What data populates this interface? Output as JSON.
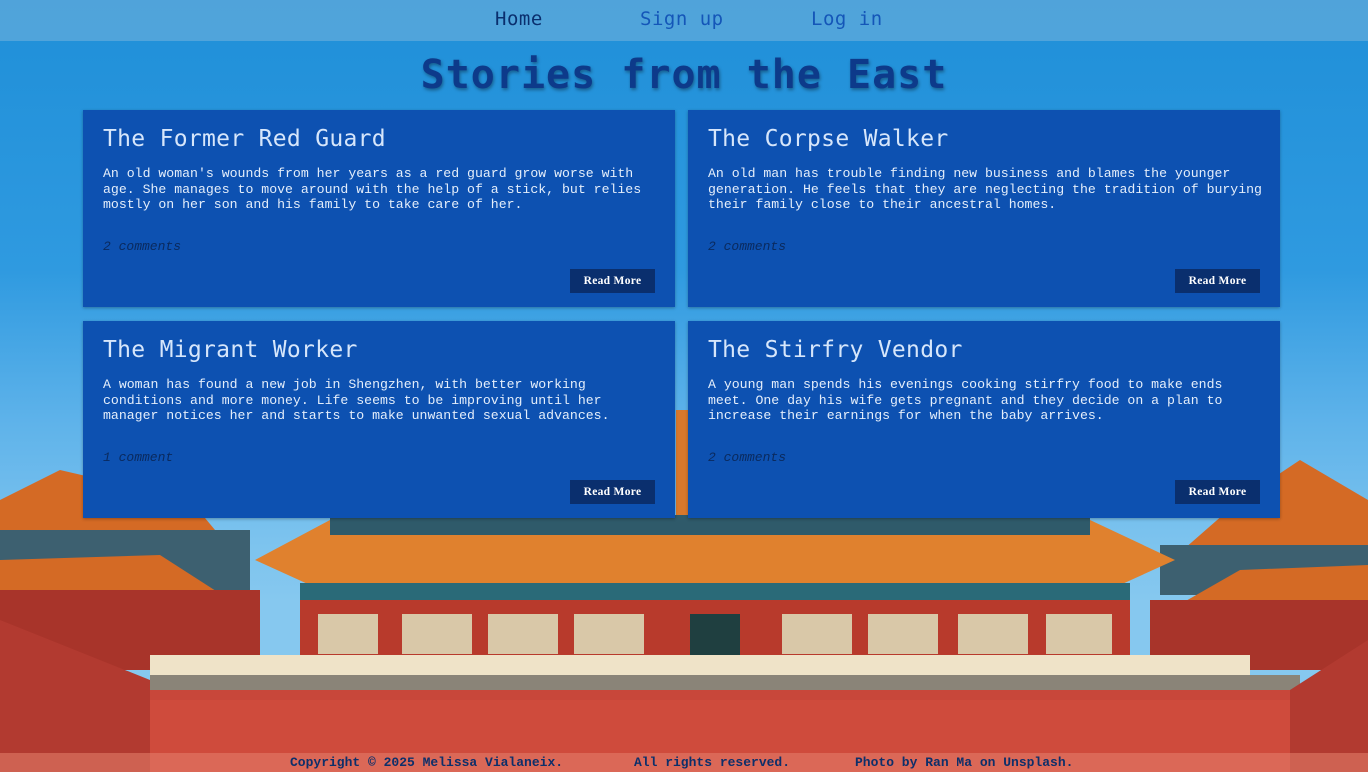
{
  "nav": {
    "home": "Home",
    "signup": "Sign up",
    "login": "Log in"
  },
  "page_title": "Stories from the East",
  "stories": [
    {
      "title": "The Former Red Guard",
      "summary": "An old woman's wounds from her years as a red guard grow worse with age. She manages to move around with the help of a stick, but relies mostly on her son and his family to take care of her.",
      "comments": "2 comments",
      "button": "Read More"
    },
    {
      "title": "The Corpse Walker",
      "summary": "An old man has trouble finding new business and blames the younger generation. He feels that they are neglecting the tradition of burying their family close to their ancestral homes.",
      "comments": "2 comments",
      "button": "Read More"
    },
    {
      "title": "The Migrant Worker",
      "summary": "A woman has found a new job in Shengzhen, with better working conditions and more money. Life seems to be improving until her manager notices her and starts to make unwanted sexual advances.",
      "comments": "1 comment",
      "button": "Read More"
    },
    {
      "title": "The Stirfry Vendor",
      "summary": "A young man spends his evenings cooking stirfry food to make ends meet. One day his wife gets pregnant and they decide on a plan to increase their earnings for when the baby arrives.",
      "comments": "2 comments",
      "button": "Read More"
    }
  ],
  "footer": {
    "copyright": "Copyright © 2025 Melissa Vialaneix.",
    "rights": "All rights reserved.",
    "photo_credit": "Photo by Ran Ma on Unsplash."
  },
  "colors": {
    "card_bg": "#0d51b1",
    "button_bg": "#0a2f6e",
    "title_color": "#0d3a8a",
    "wall_red": "#c8473a",
    "roof_orange": "#e07a2a"
  }
}
